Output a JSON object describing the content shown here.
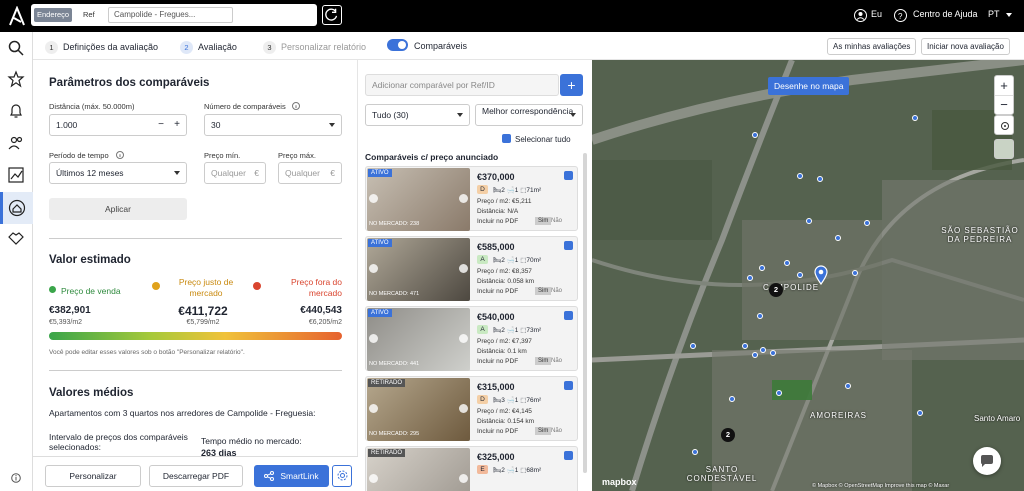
{
  "topbar": {
    "seg_address": "Endereço",
    "seg_ref": "Ref",
    "search_value": "Campolide - Fregues...",
    "user": "Eu",
    "help": "Centro de Ajuda",
    "lang": "PT"
  },
  "steps": [
    {
      "num": "1",
      "label": "Definições da avaliação"
    },
    {
      "num": "2",
      "label": "Avaliação"
    },
    {
      "num": "3",
      "label": "Personalizar relatório"
    }
  ],
  "comparaveis_toggle": "Comparáveis",
  "header_buttons": {
    "my": "As minhas avaliações",
    "new": "Iniciar nova avaliação"
  },
  "params": {
    "title": "Parâmetros dos comparáveis",
    "distance_label": "Distância (máx. 50.000m)",
    "distance_value": "1.000",
    "count_label": "Número de comparáveis",
    "count_value": "30",
    "period_label": "Período de tempo",
    "period_value": "Últimos 12 meses",
    "min_label": "Preço mín.",
    "min_placeholder": "Qualquer",
    "max_label": "Preço máx.",
    "max_placeholder": "Qualquer",
    "currency": "€",
    "apply": "Aplicar"
  },
  "estimate": {
    "title": "Valor estimado",
    "sale_label": "Preço de venda",
    "fair_label": "Preço justo de mercado",
    "off_label": "Preço fora do mercado",
    "sale_value": "€382,901",
    "sale_m2": "€5,393/m2",
    "fair_value": "€411,722",
    "fair_m2": "€5,799/m2",
    "off_value": "€440,543",
    "off_m2": "€6,205/m2",
    "note": "Você pode editar esses valores sob o botão \"Personalizar relatório\"."
  },
  "averages": {
    "title": "Valores médios",
    "desc": "Apartamentos com 3 quartos nos arredores de Campolide - Freguesia:",
    "interval_label": "Intervalo de preços dos comparáveis selecionados:",
    "time_label": "Tempo médio no mercado:",
    "time_value": "263 dias"
  },
  "bottom": {
    "personalize": "Personalizar",
    "download": "Descarregar PDF",
    "smartlink": "SmartLink"
  },
  "comparables": {
    "add_placeholder": "Adicionar comparável por Ref/ID",
    "filter_value": "Tudo (30)",
    "sort_value": "Melhor correspondência",
    "select_all": "Selecionar tudo",
    "section_title": "Comparáveis c/ preço anunciado",
    "include_pdf": "Incluir no PDF",
    "yes": "Sim",
    "no": "Não",
    "cards": [
      {
        "status": "ATIVO",
        "market": "NO MERCADO: 238",
        "price": "€370,000",
        "energy": "D",
        "beds": "2",
        "baths": "1",
        "area": "71m²",
        "m2": "Preço / m2: €5,211",
        "distance": "Distância: N/A"
      },
      {
        "status": "ATIVO",
        "market": "NO MERCADO: 471",
        "price": "€585,000",
        "energy": "A",
        "beds": "2",
        "baths": "1",
        "area": "70m²",
        "m2": "Preço / m2: €8,357",
        "distance": "Distância: 0.058 km"
      },
      {
        "status": "ATIVO",
        "market": "NO MERCADO: 441",
        "price": "€540,000",
        "energy": "A",
        "beds": "2",
        "baths": "1",
        "area": "73m²",
        "m2": "Preço / m2: €7,397",
        "distance": "Distância: 0.1 km"
      },
      {
        "status": "RETIRADO",
        "market": "NO MERCADO: 295",
        "price": "€315,000",
        "energy": "D",
        "beds": "3",
        "baths": "1",
        "area": "76m²",
        "m2": "Preço / m2: €4,145",
        "distance": "Distância: 0.154 km"
      },
      {
        "status": "RETIRADO",
        "market": "",
        "price": "€325,000",
        "energy": "E",
        "beds": "2",
        "baths": "1",
        "area": "68m²",
        "m2": "",
        "distance": ""
      }
    ]
  },
  "map": {
    "draw_button": "Desenhe no mapa",
    "labels": [
      "SÃO SEBASTIÃO DA PEDREIRA",
      "CAMPOLIDE",
      "AMOREIRAS",
      "SANTO CONDESTÁVEL",
      "Santo Amaro"
    ],
    "clusters": [
      "2",
      "2"
    ],
    "attribution": "© Mapbox © OpenStreetMap Improve this map © Maxar",
    "brand": "mapbox"
  },
  "colors": {
    "accent": "#3b72d9",
    "green": "#3aa54a",
    "amber": "#e0a21b",
    "red": "#d9452f"
  }
}
